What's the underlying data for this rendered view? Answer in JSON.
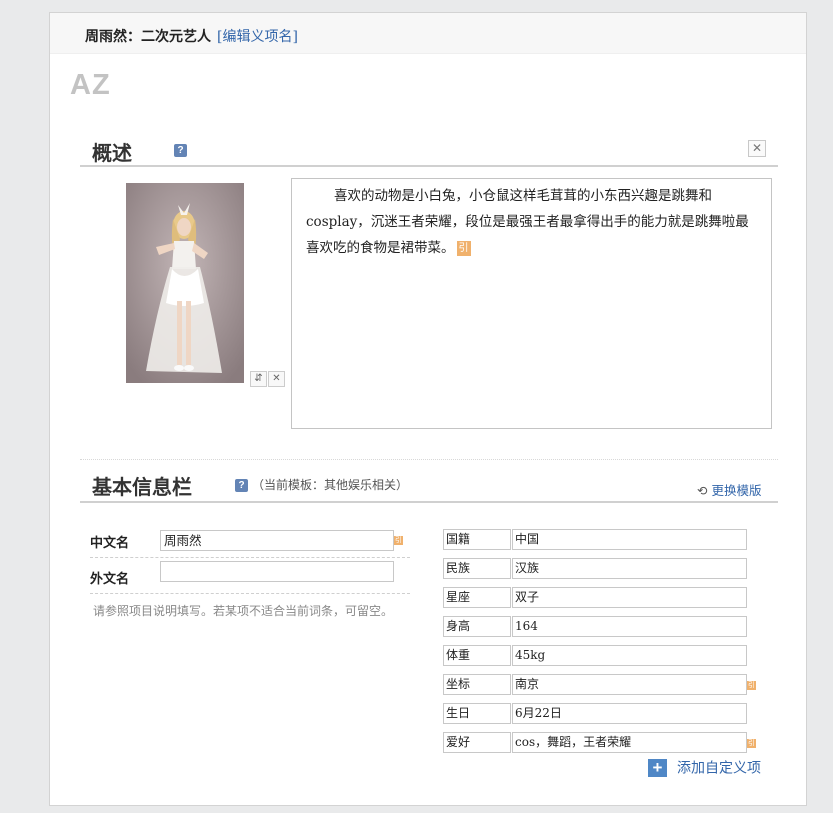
{
  "entry": {
    "title": "周雨然：二次元艺人",
    "edit_link": "[编辑义项名]",
    "az_logo": "AZ"
  },
  "summary": {
    "heading": "概述",
    "help_icon": "?",
    "close_icon": "✕",
    "text": "喜欢的动物是小白兔，小仓鼠这样毛茸茸的小东西兴趣是跳舞和cosplay，沉迷王者荣耀，段位是最强王者最拿得出手的能力就是跳舞啦最喜欢吃的食物是裙带菜。",
    "cite_mark": "引",
    "image_swap_icon": "⇵",
    "image_remove_icon": "✕"
  },
  "infobox": {
    "heading": "基本信息栏",
    "help_icon": "?",
    "template_note": "（当前模板：其他娱乐相关）",
    "switch_template": "更换模版",
    "switch_icon": "⟲",
    "chinese_name_label": "中文名",
    "chinese_name_value": "周雨然",
    "foreign_name_label": "外文名",
    "foreign_name_value": "",
    "hint": "请参照项目说明填写。若某项不适合当前词条，可留空。",
    "attributes": [
      {
        "label": "国籍",
        "value": "中国"
      },
      {
        "label": "民族",
        "value": "汉族"
      },
      {
        "label": "星座",
        "value": "双子"
      },
      {
        "label": "身高",
        "value": "164"
      },
      {
        "label": "体重",
        "value": "45kg"
      },
      {
        "label": "坐标",
        "value": "南京"
      },
      {
        "label": "生日",
        "value": "6月22日"
      },
      {
        "label": "爱好",
        "value": "cos，舞蹈，王者荣耀"
      }
    ],
    "add_custom_icon": "+",
    "add_custom_label": "添加自定义项"
  }
}
